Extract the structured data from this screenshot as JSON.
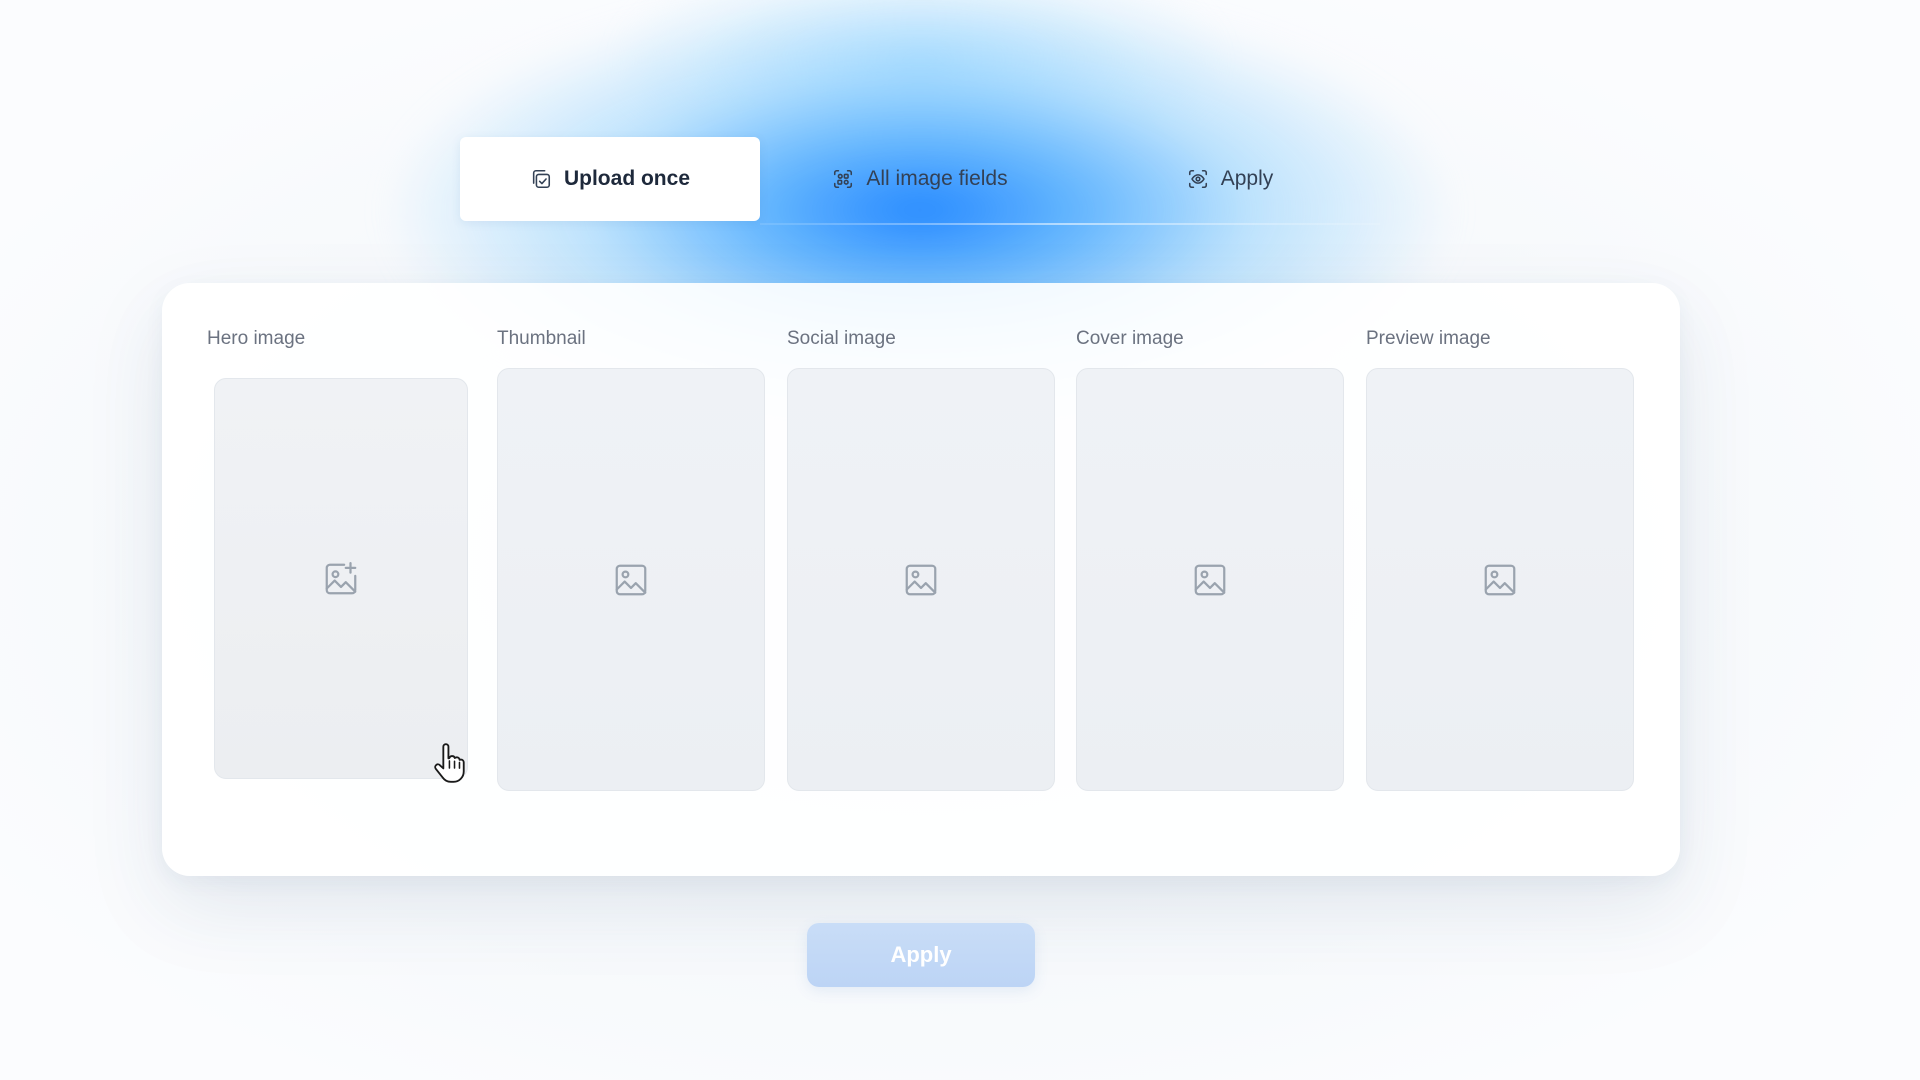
{
  "tabs": [
    {
      "label": "Upload once",
      "icon": "upload-copy-icon",
      "active": true
    },
    {
      "label": "All image fields",
      "icon": "scan-fields-icon",
      "active": false
    },
    {
      "label": "Apply",
      "icon": "eye-scan-icon",
      "active": false
    }
  ],
  "fields": [
    {
      "label": "Hero image",
      "icon": "image-add-icon"
    },
    {
      "label": "Thumbnail",
      "icon": "image-icon"
    },
    {
      "label": "Social image",
      "icon": "image-icon"
    },
    {
      "label": "Cover image",
      "icon": "image-icon"
    },
    {
      "label": "Preview image",
      "icon": "image-icon"
    }
  ],
  "apply_button": {
    "label": "Apply"
  },
  "colors": {
    "accent": "#1e88ff",
    "button_disabled": "#c4daf6",
    "text_primary": "#1e293b",
    "text_muted": "#6b7280"
  }
}
